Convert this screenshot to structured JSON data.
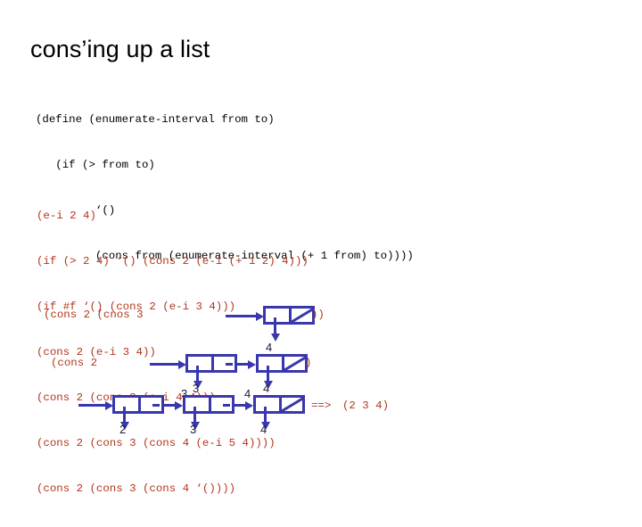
{
  "slide": {
    "title": "cons’ing up a list",
    "background_color": "#ffffff"
  },
  "colors": {
    "title_text": "#000000",
    "code_black": "#000000",
    "code_red": "#B1361C",
    "diagram_blue": "#3937AE",
    "label_dark": "#1c1c3a"
  },
  "code_define": {
    "lines": [
      "(define (enumerate-interval from to)",
      "   (if (> from to)",
      "         ‘()",
      "         (cons from (enumerate-interval (+ 1 from) to))))"
    ]
  },
  "code_trace": {
    "lines": [
      "(e-i 2 4)",
      "(if (> 2 4) ‘() (cons 2 (e-i (+ 1 2) 4)))",
      "(if #f ‘() (cons 2 (e-i 3 4)))",
      "(cons 2 (e-i 3 4))",
      "(cons 2 (cons 3 (e-i 4 4)))",
      "(cons 2 (cons 3 (cons 4 (e-i 5 4))))",
      "(cons 2 (cons 3 (cons 4 ‘())))"
    ]
  },
  "diagram": {
    "rows": [
      {
        "name": "row-1",
        "prefix_text": "(cons 2 (cnos 3",
        "suffix_text": "))",
        "cells": [
          {
            "car_label": "",
            "cdr_is_nil": true
          }
        ]
      },
      {
        "name": "row-2",
        "prefix_text": "(cons 2",
        "suffix_text": ")",
        "cells": [
          {
            "car_label": "3",
            "cdr_is_nil": false
          },
          {
            "car_label": "4",
            "cdr_is_nil": true
          }
        ],
        "top_label": "4"
      },
      {
        "name": "row-3",
        "prefix_text": "",
        "suffix_text": "",
        "cells": [
          {
            "car_label": "2",
            "cdr_is_nil": false
          },
          {
            "car_label": "3",
            "cdr_is_nil": false
          },
          {
            "car_label": "4",
            "cdr_is_nil": true
          }
        ],
        "top_labels": [
          "3",
          "4"
        ],
        "result": {
          "arrow": "==>",
          "value": "(2 3 4)"
        }
      }
    ]
  }
}
